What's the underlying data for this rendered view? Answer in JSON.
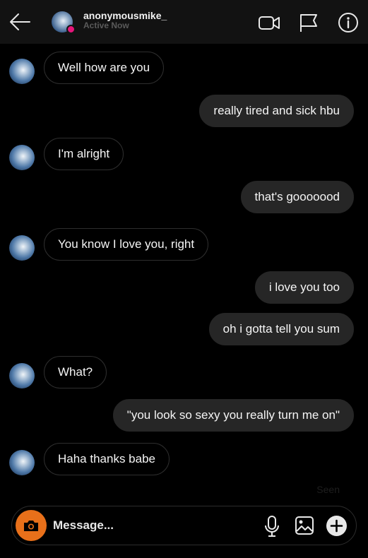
{
  "header": {
    "username": "anonymousmike_",
    "status": "Active Now",
    "icons": [
      "back-arrow-icon",
      "video-call-icon",
      "flag-icon",
      "info-icon"
    ]
  },
  "messages": [
    {
      "direction": "in",
      "text": "Well how are you"
    },
    {
      "direction": "out",
      "text": "really tired and sick hbu"
    },
    {
      "direction": "in",
      "text": "I'm alright"
    },
    {
      "direction": "out",
      "text": "that's gooooood"
    },
    {
      "direction": "in",
      "text": "You know I love you, right"
    },
    {
      "direction": "out",
      "text": "i love you too"
    },
    {
      "direction": "out",
      "text": "oh i gotta tell you sum"
    },
    {
      "direction": "in",
      "text": "What?"
    },
    {
      "direction": "out",
      "text": "\"you look so sexy you really turn me on\""
    },
    {
      "direction": "in",
      "text": "Haha thanks babe"
    }
  ],
  "seen_label": "Seen",
  "composer": {
    "placeholder": "Message...",
    "icons": [
      "camera-icon",
      "microphone-icon",
      "gallery-icon",
      "plus-icon"
    ]
  },
  "colors": {
    "background": "#000000",
    "header": "#121212",
    "outgoing_bubble": "#262626",
    "incoming_border": "#2e2e2e",
    "camera_button": "#e8701a",
    "presence_dot": "#e6157a"
  }
}
